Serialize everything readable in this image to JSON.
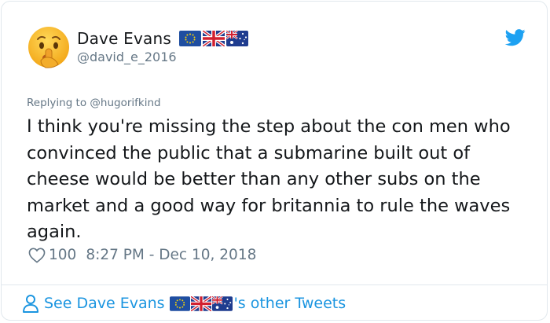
{
  "tweet": {
    "author": {
      "display_name": "Dave Evans",
      "handle": "@david_e_2016",
      "avatar_icon": "shushing-face-emoji",
      "flags": [
        "eu-flag-icon",
        "uk-flag-icon",
        "australia-flag-icon"
      ]
    },
    "reply_context": "Replying to @hugorifkind",
    "text": "I think you're missing the step about the con men who convinced the public that a submarine built out of cheese would be better than any other subs on the market and a good way for britannia to rule the waves again.",
    "likes": "100",
    "timestamp": "8:27 PM - Dec 10, 2018",
    "footer": {
      "prefix": "See Dave Evans",
      "suffix": "'s other Tweets"
    }
  },
  "colors": {
    "link": "#1b95e0",
    "secondary_text": "#657786",
    "border": "#e1e8ed"
  }
}
